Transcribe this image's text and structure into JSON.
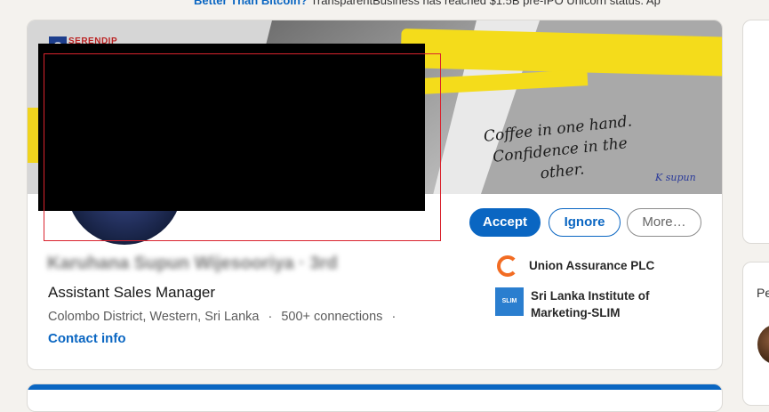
{
  "ticker": {
    "headline": "Better Than Bitcoin?",
    "rest": "TransparentBusiness has reached $1.5B pre-IPO Unicorn status. Ap"
  },
  "banner": {
    "logo_letter": "S",
    "logo_text": "SERENDIP",
    "quote": "Coffee in one hand. Confidence in the other.",
    "signature": "K supun"
  },
  "profile": {
    "name": "Karuhana Supun Wijesooriya · 3rd",
    "headline": "Assistant Sales Manager",
    "location": "Colombo District, Western, Sri Lanka",
    "separator": "·",
    "connections": "500+ connections",
    "contact_label": "Contact info"
  },
  "actions": {
    "accept_label": "Accept",
    "ignore_label": "Ignore",
    "more_label": "More…"
  },
  "companies": [
    {
      "name": "Union Assurance PLC",
      "icon": "union-assurance-logo"
    },
    {
      "name": "Sri Lanka Institute of Marketing-SLIM",
      "icon": "slim-logo",
      "icon_text": "SLIM"
    }
  ],
  "sidebar": {
    "people_label": "Pe"
  },
  "colors": {
    "accent": "#0a66c2",
    "highlight_box": "#d9232d",
    "banner_yellow": "#f4dc1b"
  }
}
